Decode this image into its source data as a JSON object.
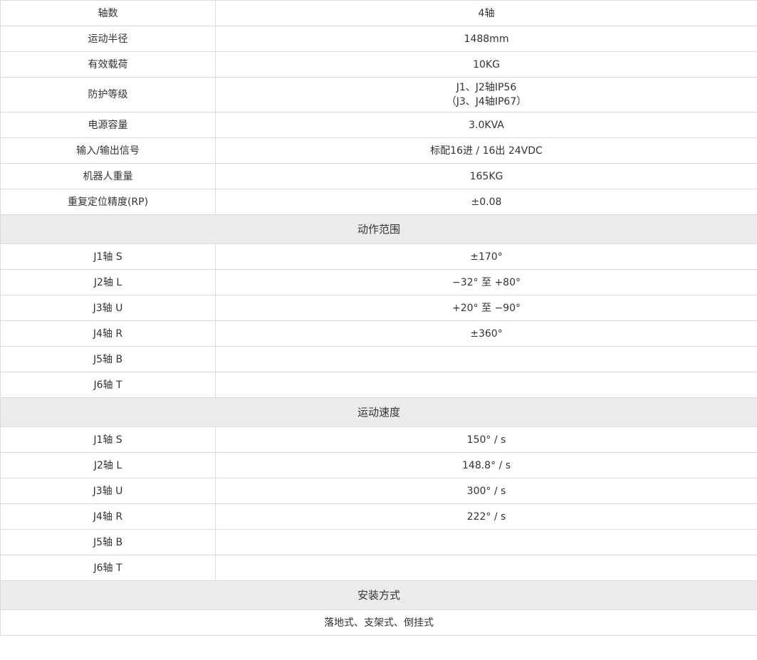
{
  "table": {
    "rows": [
      {
        "type": "row",
        "label": "轴数",
        "value": [
          "4轴"
        ]
      },
      {
        "type": "row",
        "label": "运动半径",
        "value": [
          "1488mm"
        ]
      },
      {
        "type": "row",
        "label": "有效载荷",
        "value": [
          "10KG"
        ]
      },
      {
        "type": "row",
        "label": "防护等级",
        "value": [
          "J1、J2轴IP56",
          "（J3、J4轴IP67）"
        ]
      },
      {
        "type": "row",
        "label": "电源容量",
        "value": [
          "3.0KVA"
        ]
      },
      {
        "type": "row",
        "label": "输入/输出信号",
        "value": [
          "标配16进 / 16出 24VDC"
        ]
      },
      {
        "type": "row",
        "label": "机器人重量",
        "value": [
          "165KG"
        ]
      },
      {
        "type": "row",
        "label": "重复定位精度(RP)",
        "value": [
          "±0.08"
        ]
      },
      {
        "type": "section",
        "label": "动作范围"
      },
      {
        "type": "row",
        "label": "J1轴 S",
        "value": [
          "±170°"
        ]
      },
      {
        "type": "row",
        "label": "J2轴 L",
        "value": [
          "−32° 至 +80°"
        ]
      },
      {
        "type": "row",
        "label": "J3轴 U",
        "value": [
          "+20° 至 −90°"
        ]
      },
      {
        "type": "row",
        "label": "J4轴 R",
        "value": [
          "±360°"
        ]
      },
      {
        "type": "row",
        "label": "J5轴 B",
        "value": [
          ""
        ]
      },
      {
        "type": "row",
        "label": "J6轴 T",
        "value": [
          ""
        ]
      },
      {
        "type": "section",
        "label": "运动速度"
      },
      {
        "type": "row",
        "label": "J1轴 S",
        "value": [
          "150° / s"
        ]
      },
      {
        "type": "row",
        "label": "J2轴 L",
        "value": [
          "148.8° / s"
        ]
      },
      {
        "type": "row",
        "label": "J3轴 U",
        "value": [
          "300° / s"
        ]
      },
      {
        "type": "row",
        "label": "J4轴 R",
        "value": [
          "222° / s"
        ]
      },
      {
        "type": "row",
        "label": "J5轴 B",
        "value": [
          ""
        ]
      },
      {
        "type": "row",
        "label": "J6轴 T",
        "value": [
          ""
        ]
      },
      {
        "type": "section",
        "label": "安装方式"
      },
      {
        "type": "full",
        "label": "落地式、支架式、倒挂式"
      }
    ]
  },
  "colors": {
    "border": "#dcdcdc",
    "section_bg": "#ebebeb",
    "text": "#333333"
  }
}
